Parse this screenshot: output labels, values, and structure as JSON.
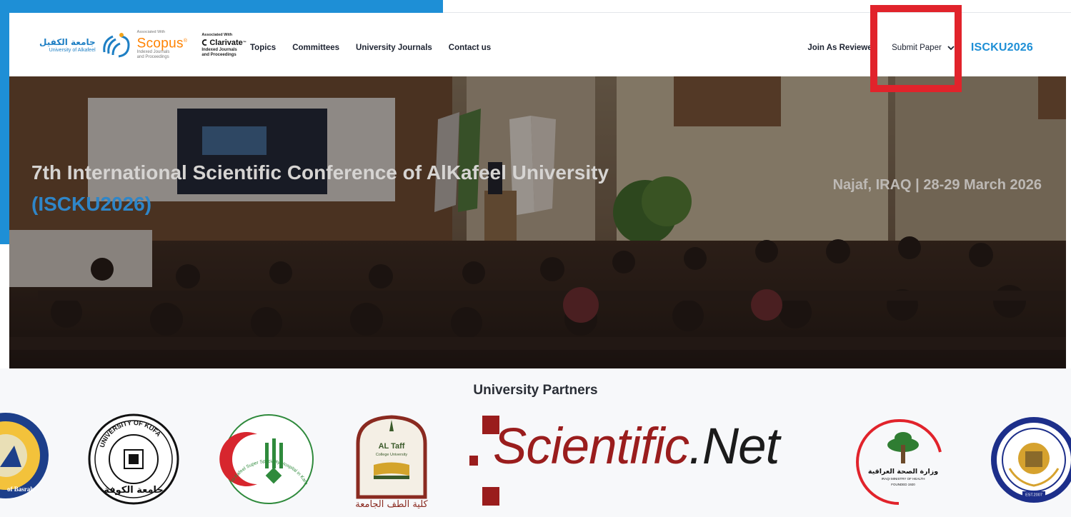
{
  "header": {
    "university_ar": "جامعة الكفيل",
    "university_en": "University of Alkafeel",
    "scopus": {
      "associated": "Associated With",
      "name": "Scopus",
      "indexed_line1": "Indexed Journals",
      "indexed_line2": "and Proceedings"
    },
    "clarivate": {
      "associated": "Associated With",
      "name": "Clarivate",
      "indexed_line1": "Indexed Journals",
      "indexed_line2": "and Proceedings"
    },
    "nav_left": [
      "Topics",
      "Committees",
      "University Journals",
      "Contact us"
    ],
    "join_label": "Join As Reviewer",
    "submit_label": "Submit Paper",
    "conference_code": "ISCKU2026"
  },
  "hero": {
    "title": "7th International Scientific Conference of AlKafeel University",
    "code": "(ISCKU2026)",
    "location_date": "Najaf, IRAQ | 28-29 March 2026"
  },
  "partners": {
    "title": "University Partners",
    "logos": [
      {
        "name": "University of Basrah",
        "text": "of Basrah"
      },
      {
        "name": "University of Kufa",
        "text_en": "UNIVERSITY OF KUFA",
        "text_ar": "جامعة الكوفة"
      },
      {
        "name": "Alkafeel Super Speciality Hospital",
        "text_en": "Al-Kafeel Super Speciality Hospital in Karbala"
      },
      {
        "name": "Al Taff University College",
        "text_en": "AL Taff",
        "text_sub": "College University",
        "text_ar": "كلية الطف الجامعة"
      },
      {
        "name": "Scientific.Net",
        "word1": "Scientific",
        "word2": ".Net"
      },
      {
        "name": "Iraqi Ministry of Health",
        "text_ar": "وزارة الصحة العراقية",
        "text_en": "IRAQI MINISTRY OF HEALTH",
        "founded": "FOUNDED 1920"
      },
      {
        "name": "University of Muthanna",
        "est": "EST.2007"
      }
    ]
  },
  "colors": {
    "accent_blue": "#1e8fd6",
    "scopus_orange": "#ff8200",
    "highlight_red": "#e1232b",
    "scientific_red": "#9a1d1d"
  }
}
